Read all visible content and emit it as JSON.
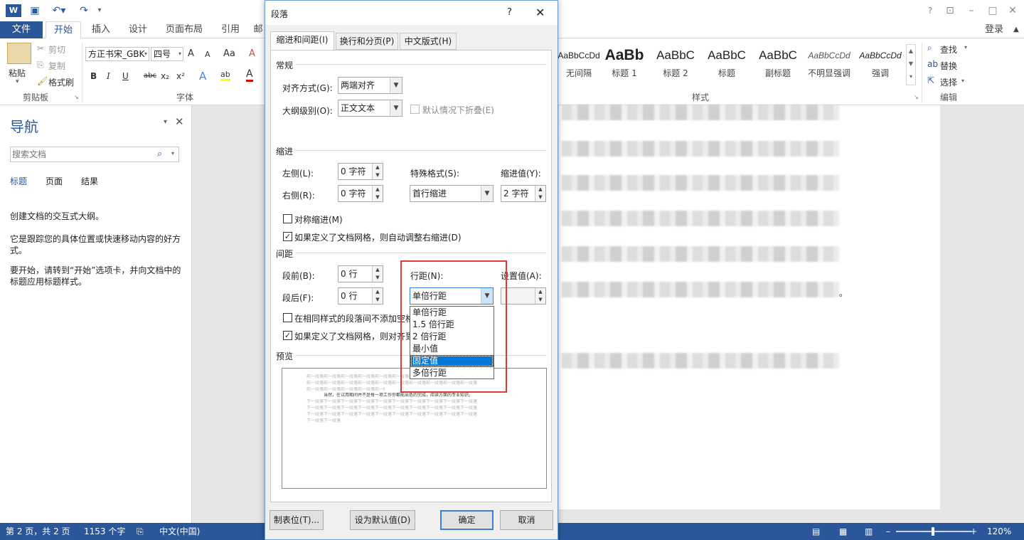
{
  "app": {
    "help": "?",
    "login": "登录",
    "tabs": [
      "文件",
      "开始",
      "插入",
      "设计",
      "页面布局",
      "引用",
      "邮"
    ]
  },
  "ribbon": {
    "clipboard": {
      "paste": "粘贴",
      "cut": "剪切",
      "copy": "复制",
      "format_painter": "格式刷",
      "group": "剪贴板"
    },
    "font": {
      "name": "方正书宋_GBK",
      "size": "四号",
      "group": "字体",
      "bold": "B",
      "italic": "I",
      "underline": "U",
      "strike": "abc",
      "sub": "x₂",
      "sup": "x²",
      "grow": "A",
      "shrink": "A",
      "case": "Aa",
      "clear": "A",
      "effects": "A",
      "highlight": "ab",
      "color": "A"
    },
    "styles": {
      "group": "样式",
      "items": [
        {
          "sample": "AaBbCcDd",
          "name": "无间隔"
        },
        {
          "sample": "AaBb",
          "name": "标题 1"
        },
        {
          "sample": "AaBbC",
          "name": "标题 2"
        },
        {
          "sample": "AaBbC",
          "name": "标题"
        },
        {
          "sample": "AaBbC",
          "name": "副标题"
        },
        {
          "sample": "AaBbCcDd",
          "name": "不明显强调"
        },
        {
          "sample": "AaBbCcDd",
          "name": "强调"
        }
      ]
    },
    "editing": {
      "find": "查找",
      "replace": "替换",
      "select": "选择",
      "group": "编辑"
    }
  },
  "nav": {
    "title": "导航",
    "search_placeholder": "搜索文档",
    "tabs": [
      "标题",
      "页面",
      "结果"
    ],
    "text1": "创建文档的交互式大纲。",
    "text2": "它是跟踪您的具体位置或快速移动内容的好方式。",
    "text3": "要开始，请转到“开始”选项卡，并向文档中的标题应用标题样式。"
  },
  "doc": {
    "end_mark": "。"
  },
  "status": {
    "page": "第 2 页，共 2 页",
    "words": "1153 个字",
    "lang": "中文(中国)",
    "zoom": "120%"
  },
  "dialog": {
    "title": "段落",
    "help": "?",
    "tabs": [
      "缩进和间距(I)",
      "换行和分页(P)",
      "中文版式(H)"
    ],
    "general": {
      "heading": "常规",
      "align_label": "对齐方式(G):",
      "align_value": "两端对齐",
      "outline_label": "大纲级别(O):",
      "outline_value": "正文文本",
      "collapse_label": "默认情况下折叠(E)"
    },
    "indent": {
      "heading": "缩进",
      "left_label": "左侧(L):",
      "left_value": "0 字符",
      "right_label": "右侧(R):",
      "right_value": "0 字符",
      "special_label": "特殊格式(S):",
      "special_value": "首行缩进",
      "by_label": "缩进值(Y):",
      "by_value": "2 字符",
      "mirror_label": "对称缩进(M)",
      "auto_label": "如果定义了文档网格，则自动调整右缩进(D)"
    },
    "spacing": {
      "heading": "间距",
      "before_label": "段前(B):",
      "before_value": "0 行",
      "after_label": "段后(F):",
      "after_value": "0 行",
      "line_label": "行距(N):",
      "line_value": "单倍行距",
      "at_label": "设置值(A):",
      "at_value": "",
      "nospace_label": "在相同样式的段落间不添加空格",
      "snap_label": "如果定义了文档网格，则对齐到网格"
    },
    "preview": {
      "heading": "预览",
      "prev_line": "前一段落前一段落前一段落前一段落前一段落前一段落前一段落前一段落前一段落前一段落",
      "sample_line": "当然，在试用期间并不是每一项工作你都能出色的完成，阅读方面的专业知识。",
      "next_line": "下一段落下一段落下一段落下一段落下一段落下一段落下一段落下一段落下一段落下一段落",
      "last_line": "下一段落下一段落"
    },
    "dropdown_options": [
      "单倍行距",
      "1.5 倍行距",
      "2 倍行距",
      "最小值",
      "固定值",
      "多倍行距"
    ],
    "dropdown_selected": "固定值",
    "buttons": {
      "tabs": "制表位(T)...",
      "default": "设为默认值(D)",
      "ok": "确定",
      "cancel": "取消"
    }
  }
}
